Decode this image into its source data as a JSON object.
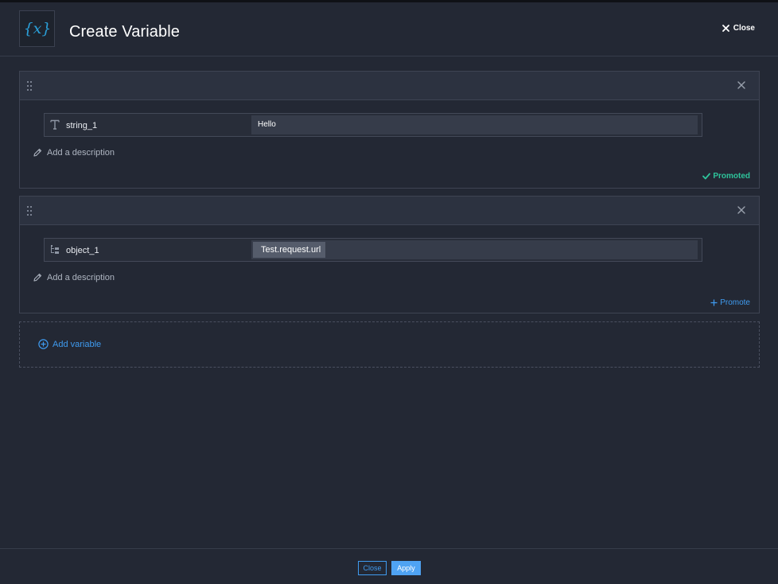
{
  "header": {
    "title": "Create Variable",
    "close_label": "Close",
    "logo_icon": "variable-x-icon"
  },
  "variables": [
    {
      "name": "string_1",
      "type_icon": "text-type-icon",
      "value": "Hello",
      "description_placeholder": "Add a description",
      "status": "Promoted"
    },
    {
      "name": "object_1",
      "type_icon": "object-type-icon",
      "value": "Test.request.url",
      "description_placeholder": "Add a description",
      "promote_label": "Promote"
    }
  ],
  "add_variable_label": "Add variable",
  "footer": {
    "close_label": "Close",
    "apply_label": "Apply"
  },
  "colors": {
    "background": "#232834",
    "accent": "#3f9bf0",
    "promoted": "#2ec49b",
    "logo_accent": "#2a9fd8"
  }
}
